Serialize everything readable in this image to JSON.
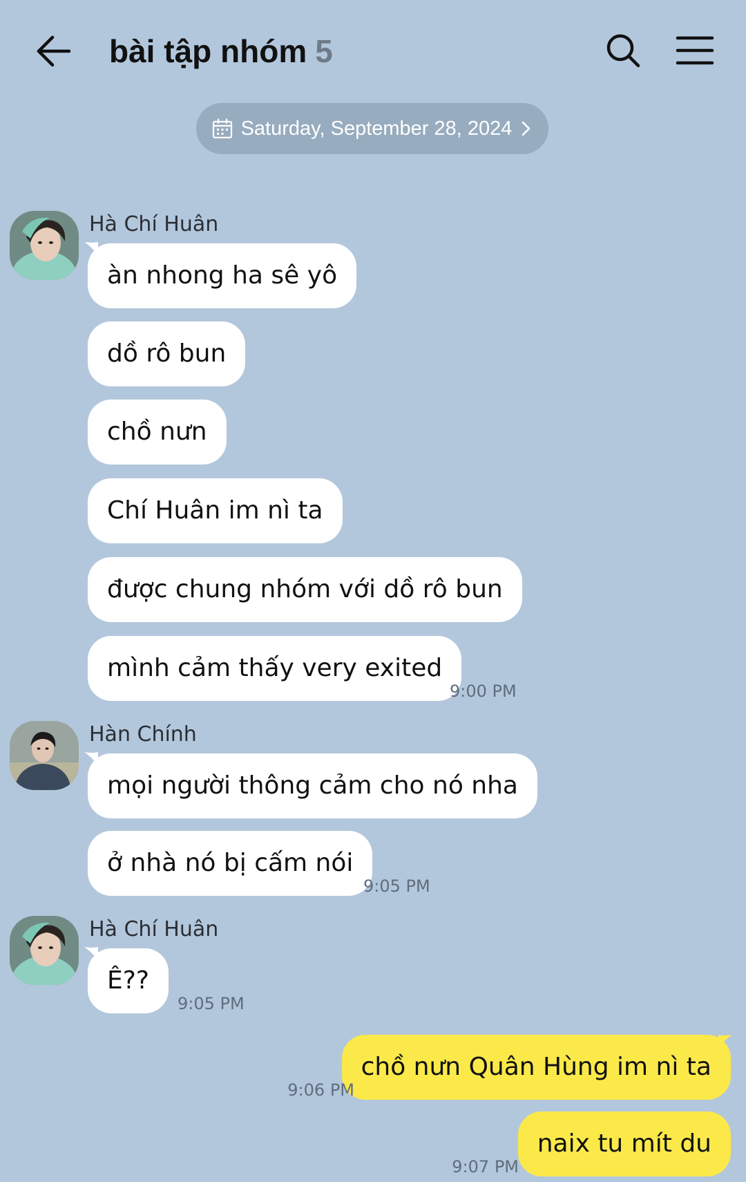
{
  "header": {
    "title": "bài tập nhóm",
    "member_count": "5"
  },
  "date_separator": {
    "label": "Saturday, September 28, 2024"
  },
  "messages": {
    "group1": {
      "sender": "Hà Chí Huân",
      "lines": [
        "àn nhong ha sê yô",
        "dồ rô bun",
        "chồ nưn",
        "Chí Huân im nì ta",
        "được chung nhóm với dồ rô bun",
        "mình cảm thấy very exited"
      ],
      "time": "9:00 PM"
    },
    "group2": {
      "sender": "Hàn Chính",
      "lines": [
        "mọi người thông cảm cho nó nha",
        "ở nhà nó bị cấm nói"
      ],
      "time": "9:05 PM"
    },
    "group3": {
      "sender": "Hà Chí Huân",
      "lines": [
        "Ê??"
      ],
      "time": "9:05 PM"
    },
    "outgoing1": {
      "text": "chồ nưn Quân Hùng im nì ta",
      "time": "9:06 PM"
    },
    "outgoing2": {
      "text": "naix tu mít du",
      "time": "9:07 PM"
    }
  },
  "colors": {
    "background": "#b3c7dc",
    "outgoing_bubble": "#fbe94a",
    "incoming_bubble": "#ffffff",
    "date_pill": "#98acbf"
  },
  "icons": {
    "back": "arrow-left-icon",
    "search": "search-icon",
    "menu": "hamburger-menu-icon",
    "calendar": "calendar-icon",
    "chevron": "chevron-right-icon"
  }
}
